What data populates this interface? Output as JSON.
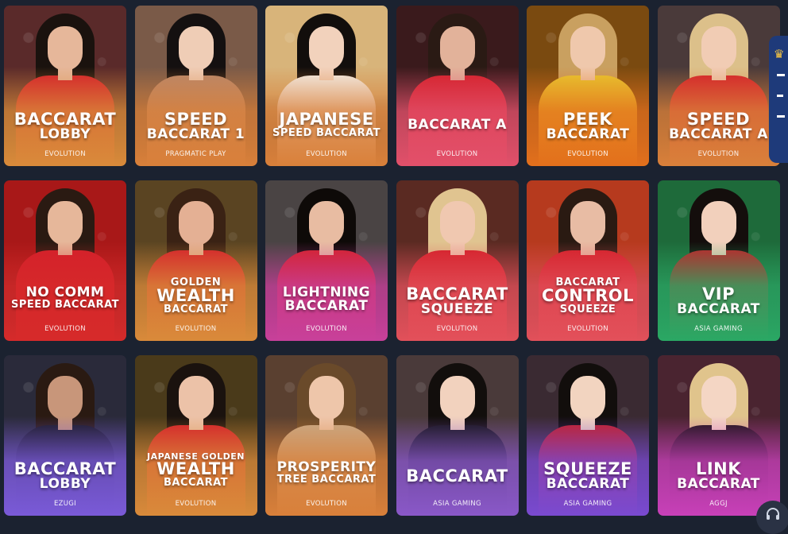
{
  "games": [
    {
      "lines": [
        {
          "t": "BACCARAT",
          "s": "big"
        },
        {
          "t": "LOBBY",
          "s": "med"
        }
      ],
      "provider": "EVOLUTION",
      "bg": "#5a2a2a",
      "grad": "#d98a3a",
      "hair": "#1a120e",
      "skin": "#e6b79a",
      "outfit": "#d4202a"
    },
    {
      "lines": [
        {
          "t": "SPEED",
          "s": "big"
        },
        {
          "t": "BACCARAT 1",
          "s": "med"
        }
      ],
      "provider": "PRAGMATIC PLAY",
      "bg": "#7a5a48",
      "grad": "#d9803a",
      "hair": "#141010",
      "skin": "#efcdb6",
      "outfit": "#b9876a"
    },
    {
      "lines": [
        {
          "t": "JAPANESE",
          "s": "big"
        },
        {
          "t": "SPEED BACCARAT",
          "s": "small"
        }
      ],
      "provider": "EVOLUTION",
      "bg": "#d8b47a",
      "grad": "#d9803a",
      "hair": "#120e0c",
      "skin": "#f2d2bc",
      "outfit": "#f4f1ec"
    },
    {
      "lines": [
        {
          "t": "BACCARAT A",
          "s": "med"
        }
      ],
      "provider": "EVOLUTION",
      "bg": "#3a1a1c",
      "grad": "#e2506a",
      "hair": "#2a1a14",
      "skin": "#e2b29a",
      "outfit": "#d4202a"
    },
    {
      "lines": [
        {
          "t": "PEEK",
          "s": "big"
        },
        {
          "t": "BACCARAT",
          "s": "med"
        }
      ],
      "provider": "EVOLUTION",
      "bg": "#7a4a10",
      "grad": "#e3701c",
      "hair": "#c9a060",
      "skin": "#efc8ac",
      "outfit": "#e8c830"
    },
    {
      "lines": [
        {
          "t": "SPEED",
          "s": "big"
        },
        {
          "t": "BACCARAT A",
          "s": "med"
        }
      ],
      "provider": "EVOLUTION",
      "bg": "#4a3a3a",
      "grad": "#d9803a",
      "hair": "#dcc08a",
      "skin": "#f1ccb4",
      "outfit": "#d4202a"
    },
    {
      "lines": [
        {
          "t": "NO COMM",
          "s": "med"
        },
        {
          "t": "SPEED BACCARAT",
          "s": "small"
        }
      ],
      "provider": "EVOLUTION",
      "bg": "#a81818",
      "grad": "#d62a2a",
      "hair": "#2a1a12",
      "skin": "#e6b79a",
      "outfit": "#d4202a"
    },
    {
      "lines": [
        {
          "t": "GOLDEN",
          "s": "small"
        },
        {
          "t": "WEALTH",
          "s": "big"
        },
        {
          "t": "BACCARAT",
          "s": "small"
        }
      ],
      "provider": "EVOLUTION",
      "bg": "#5a4422",
      "grad": "#d98a3a",
      "hair": "#3a2214",
      "skin": "#e4b094",
      "outfit": "#d4202a"
    },
    {
      "lines": [
        {
          "t": "LIGHTNING",
          "s": "med"
        },
        {
          "t": "BACCARAT",
          "s": "med"
        }
      ],
      "provider": "EVOLUTION",
      "bg": "#4a4444",
      "grad": "#c8409a",
      "hair": "#0e0a08",
      "skin": "#e8bca2",
      "outfit": "#d4202a"
    },
    {
      "lines": [
        {
          "t": "BACCARAT",
          "s": "big"
        },
        {
          "t": "SQUEEZE",
          "s": "med"
        }
      ],
      "provider": "EVOLUTION",
      "bg": "#5a2a22",
      "grad": "#e2505a",
      "hair": "#e0c490",
      "skin": "#f0c8b0",
      "outfit": "#d4202a"
    },
    {
      "lines": [
        {
          "t": "BACCARAT",
          "s": "small"
        },
        {
          "t": "CONTROL",
          "s": "big"
        },
        {
          "t": "SQUEEZE",
          "s": "small"
        }
      ],
      "provider": "EVOLUTION",
      "bg": "#b63a1e",
      "grad": "#e2505a",
      "hair": "#2a1a12",
      "skin": "#e8bca4",
      "outfit": "#d4202a"
    },
    {
      "lines": [
        {
          "t": "VIP",
          "s": "big"
        },
        {
          "t": "BACCARAT",
          "s": "med"
        }
      ],
      "provider": "ASIA GAMING",
      "bg": "#1e6a3a",
      "grad": "#2aa864",
      "hair": "#140e0c",
      "skin": "#f2d0bc",
      "outfit": "#c42028"
    },
    {
      "lines": [
        {
          "t": "BACCARAT",
          "s": "big"
        },
        {
          "t": "LOBBY",
          "s": "med"
        }
      ],
      "provider": "EZUGI",
      "bg": "#2a2a3a",
      "grad": "#7a5ad8",
      "hair": "#2a1a12",
      "skin": "#c8967a",
      "outfit": "#1a1a24"
    },
    {
      "lines": [
        {
          "t": "JAPANESE GOLDEN",
          "s": "tiny"
        },
        {
          "t": "WEALTH",
          "s": "big"
        },
        {
          "t": "BACCARAT",
          "s": "small"
        }
      ],
      "provider": "EVOLUTION",
      "bg": "#4a3a1a",
      "grad": "#d98a3a",
      "hair": "#1a120e",
      "skin": "#ecc2a8",
      "outfit": "#d4202a"
    },
    {
      "lines": [
        {
          "t": "PROSPERITY",
          "s": "med"
        },
        {
          "t": "TREE BACCARAT",
          "s": "small"
        }
      ],
      "provider": "EVOLUTION",
      "bg": "#5a4030",
      "grad": "#d9803a",
      "hair": "#6a4a2a",
      "skin": "#eec6aa",
      "outfit": "#c8aa88"
    },
    {
      "lines": [
        {
          "t": "BACCARAT",
          "s": "big"
        }
      ],
      "provider": "ASIA GAMING",
      "bg": "#4a3a3a",
      "grad": "#8a58c8",
      "hair": "#120e0c",
      "skin": "#f2d2be",
      "outfit": "#141418"
    },
    {
      "lines": [
        {
          "t": "SQUEEZE",
          "s": "big"
        },
        {
          "t": "BACCARAT",
          "s": "med"
        }
      ],
      "provider": "ASIA GAMING",
      "bg": "#3a2a32",
      "grad": "#7a4ad0",
      "hair": "#120e0c",
      "skin": "#f2d4c0",
      "outfit": "#c42028"
    },
    {
      "lines": [
        {
          "t": "LINK",
          "s": "big"
        },
        {
          "t": "BACCARAT",
          "s": "med"
        }
      ],
      "provider": "AGGJ",
      "bg": "#4a2430",
      "grad": "#c840b8",
      "hair": "#e0c48c",
      "skin": "#f4d6c4",
      "outfit": "#1a1418"
    }
  ],
  "side_tab": {
    "icon": "crown-icon"
  },
  "support": {
    "icon": "headset-icon"
  }
}
